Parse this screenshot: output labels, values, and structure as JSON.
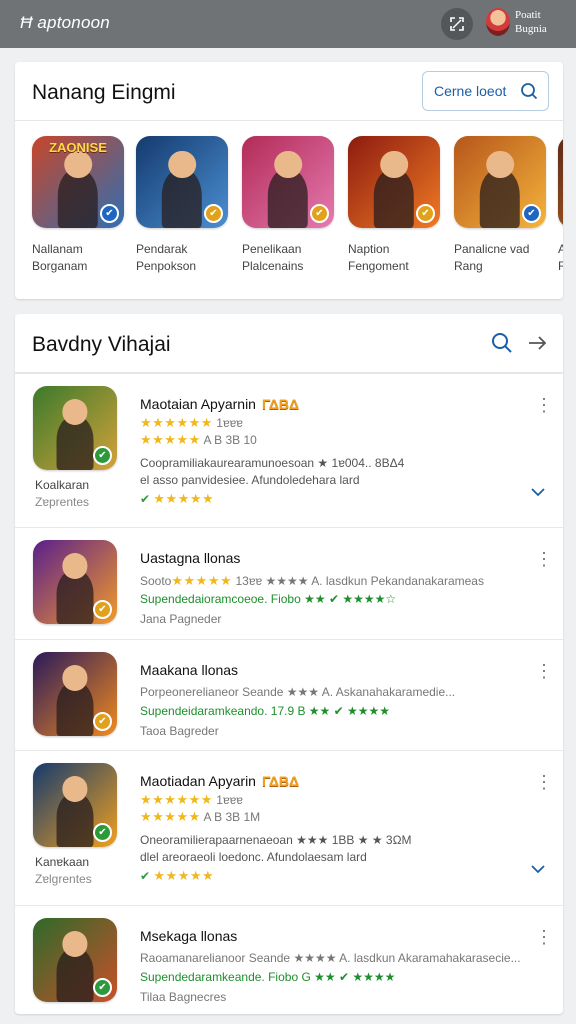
{
  "topbar": {
    "app_title": "Ħ aptonoon",
    "user_name_line1": "Poatit",
    "user_name_line2": "Bugnia",
    "icons": [
      "expand-icon",
      "avatar"
    ]
  },
  "featured": {
    "title": "Nanang Eingmi",
    "see_more_label": "Cerne loeot",
    "see_more_icon": "search-icon",
    "items": [
      {
        "icon_text": "ZAONISE",
        "line1": "Nallanam",
        "line2": "Borganam",
        "colors": [
          "#c7462a",
          "#2f6fb2"
        ],
        "badge_color": "#1f66c2"
      },
      {
        "icon_text": "",
        "line1": "Pendarak",
        "line2": "Penpokson",
        "colors": [
          "#143a6e",
          "#4b8fd2"
        ],
        "badge_color": "#e2a11a"
      },
      {
        "icon_text": "",
        "line1": "Penelikaan",
        "line2": "Plalcenains",
        "colors": [
          "#b22b57",
          "#e57ab0"
        ],
        "badge_color": "#e2a11a"
      },
      {
        "icon_text": "",
        "line1": "Naption",
        "line2": "Fengoment",
        "colors": [
          "#8c1b10",
          "#f07a24"
        ],
        "badge_color": "#e2a11a"
      },
      {
        "icon_text": "",
        "line1": "Panalicne vad",
        "line2": "Rang",
        "colors": [
          "#b5561b",
          "#f5b43b"
        ],
        "badge_color": "#1f66c2"
      },
      {
        "icon_text": "",
        "line1": "A",
        "line2": "R",
        "colors": [
          "#5b2a14",
          "#c86a2a"
        ],
        "badge_color": "#1f66c2"
      }
    ]
  },
  "list": {
    "title": "Bavdny Vihajai",
    "icons": [
      "search-icon",
      "arrow-right-icon"
    ],
    "items": [
      {
        "title": "Maotaian Apyarnin",
        "gold_tag": "ΓΔΒΔ",
        "rating_row_stars": "★★★★★★",
        "rating_row_text": "1ɐɐɐ",
        "rating_row2_stars": "★★★★★",
        "rating_row2_text": "A Β   3Β 10",
        "line3": "Coopramiliakaurearamunoesoan  ★ 1ɐ004.. 8ΒΔ4",
        "line4_prefix": "el",
        "line4": "asso panvidesiee.  Afundoledehara  lard",
        "line5_prefix": "✔",
        "line5_stars": "★★★★★",
        "sub_line1": "Koalkaran",
        "sub_line2": "Zɐprentes",
        "has_expand": true,
        "colors": [
          "#3b7a2b",
          "#d4a23a"
        ],
        "badge_color": "#2c9a3a"
      },
      {
        "title": "Uastagna llonas",
        "line1_prefix": "Sooto",
        "line1_stars": "★★★★★",
        "line1_text": "13ɐɐ   ★★★★ A. lasdkun Pekandanakarameas",
        "line2": "Supendedaioramcoeoe.  Fiobo ★★ ✔ ★★★★☆",
        "line3": "Jana Pagneder",
        "colors": [
          "#5a1f8c",
          "#f29a2a"
        ],
        "badge_color": "#e2a11a"
      },
      {
        "title": "Maakana llonas",
        "line1": "Porpeonerelianeor Seande  ★★★ A. Askanahakaramedie...",
        "line2": "Supendeidaramkeando.  17.9 B  ★★ ✔ ★★★★",
        "line3": "Taoa Bagreder",
        "colors": [
          "#2a1a5c",
          "#f08a1e"
        ],
        "badge_color": "#e2a11a"
      },
      {
        "title": "Maotiadan Apyarin",
        "gold_tag": "ΓΔΒΔ",
        "rating_row_stars": "★★★★★★",
        "rating_row_text": "1ɐɐɐ",
        "rating_row2_stars": "★★★★★",
        "rating_row2_text": "A Β   3Β 1M",
        "line3": "Oneoramilierapaarnenaeoan  ★★★  1ΒΒ  ★ ★ 3ΩM",
        "line4_prefix": "dlel",
        "line4": "areoraeoli loedonc.  Afundolaesam  lard",
        "line5_prefix": "✔",
        "line5_stars": "★★★★★",
        "sub_line1": "Kanɐkaan",
        "sub_line2": "Zɐlgrentes",
        "has_expand": true,
        "colors": [
          "#153a6e",
          "#f0a020"
        ],
        "badge_color": "#2c9a3a"
      },
      {
        "title": "Msekaga llonas",
        "line1": "Raoamanarelianoor Seande  ★★★★ A. lasdkun  Akaramahakarasecie...",
        "line2": "Supendedaramkeande.  Fiobo G ★★ ✔ ★★★★",
        "line3": "Tilaa Bagnecres",
        "colors": [
          "#2e6a2a",
          "#c8502a"
        ],
        "badge_color": "#2c9a3a"
      }
    ]
  }
}
